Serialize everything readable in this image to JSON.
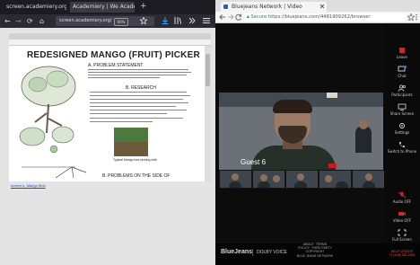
{
  "left_browser": {
    "tabs": [
      {
        "label": "screen.academiery.org/"
      },
      {
        "label": "Academiery | We Academy of"
      }
    ],
    "new_tab": "+",
    "nav": {
      "back": "←",
      "forward": "→",
      "reload": "⟳",
      "home": "⌂"
    },
    "url": "screen.academiery.org/",
    "zoom": "90%",
    "toolbar_icons": [
      "star-icon",
      "download-icon",
      "library-icon",
      "menu-icon"
    ],
    "document": {
      "title": "REDESIGNED MANGO (FRUIT) PICKER",
      "section_a": "A.   PROBLEM STATEMENT",
      "section_b": "B.   RESEARCH",
      "section_c": "B.   PROBLEMS ON THE SIDE OF",
      "photo_caption": "Typical Mango tree picking with",
      "link": "screen.u, Mango Mob"
    }
  },
  "right_browser": {
    "tab_title": "Bluejeans Network | Video",
    "url_secure": "Secure",
    "url_host": "https://bluejeans.com/4481909262/browser",
    "guest_label": "Guest 6",
    "sidebar": [
      {
        "icon": "leave-icon",
        "label": "Leave"
      },
      {
        "icon": "chat-icon",
        "label": "Chat"
      },
      {
        "icon": "participants-icon",
        "label": "Participants"
      },
      {
        "icon": "share-screen-icon",
        "label": "Share Screen"
      },
      {
        "icon": "settings-icon",
        "label": "Settings"
      },
      {
        "icon": "switch-phone-icon",
        "label": "Switch to Phone"
      },
      {
        "icon": "audio-off-icon",
        "label": "Audio OFF"
      },
      {
        "icon": "video-off-icon",
        "label": "Video OFF"
      },
      {
        "icon": "full-screen-icon",
        "label": "Full Screen"
      }
    ],
    "chat_badge": "1",
    "footer": {
      "brand": "BlueJeans",
      "dolby": "DOLBY VOICE",
      "links": [
        "ABOUT",
        "TERMS",
        "POLICY",
        "THIRD PARTY",
        "COPYRIGHT",
        "BLUE JEANS NETWORK"
      ],
      "help": [
        "HELP CENTER",
        "+1 (408) 550-2828"
      ]
    },
    "colors": {
      "accent_red": "#c31e25",
      "secure_green": "#1a8f2e"
    }
  }
}
